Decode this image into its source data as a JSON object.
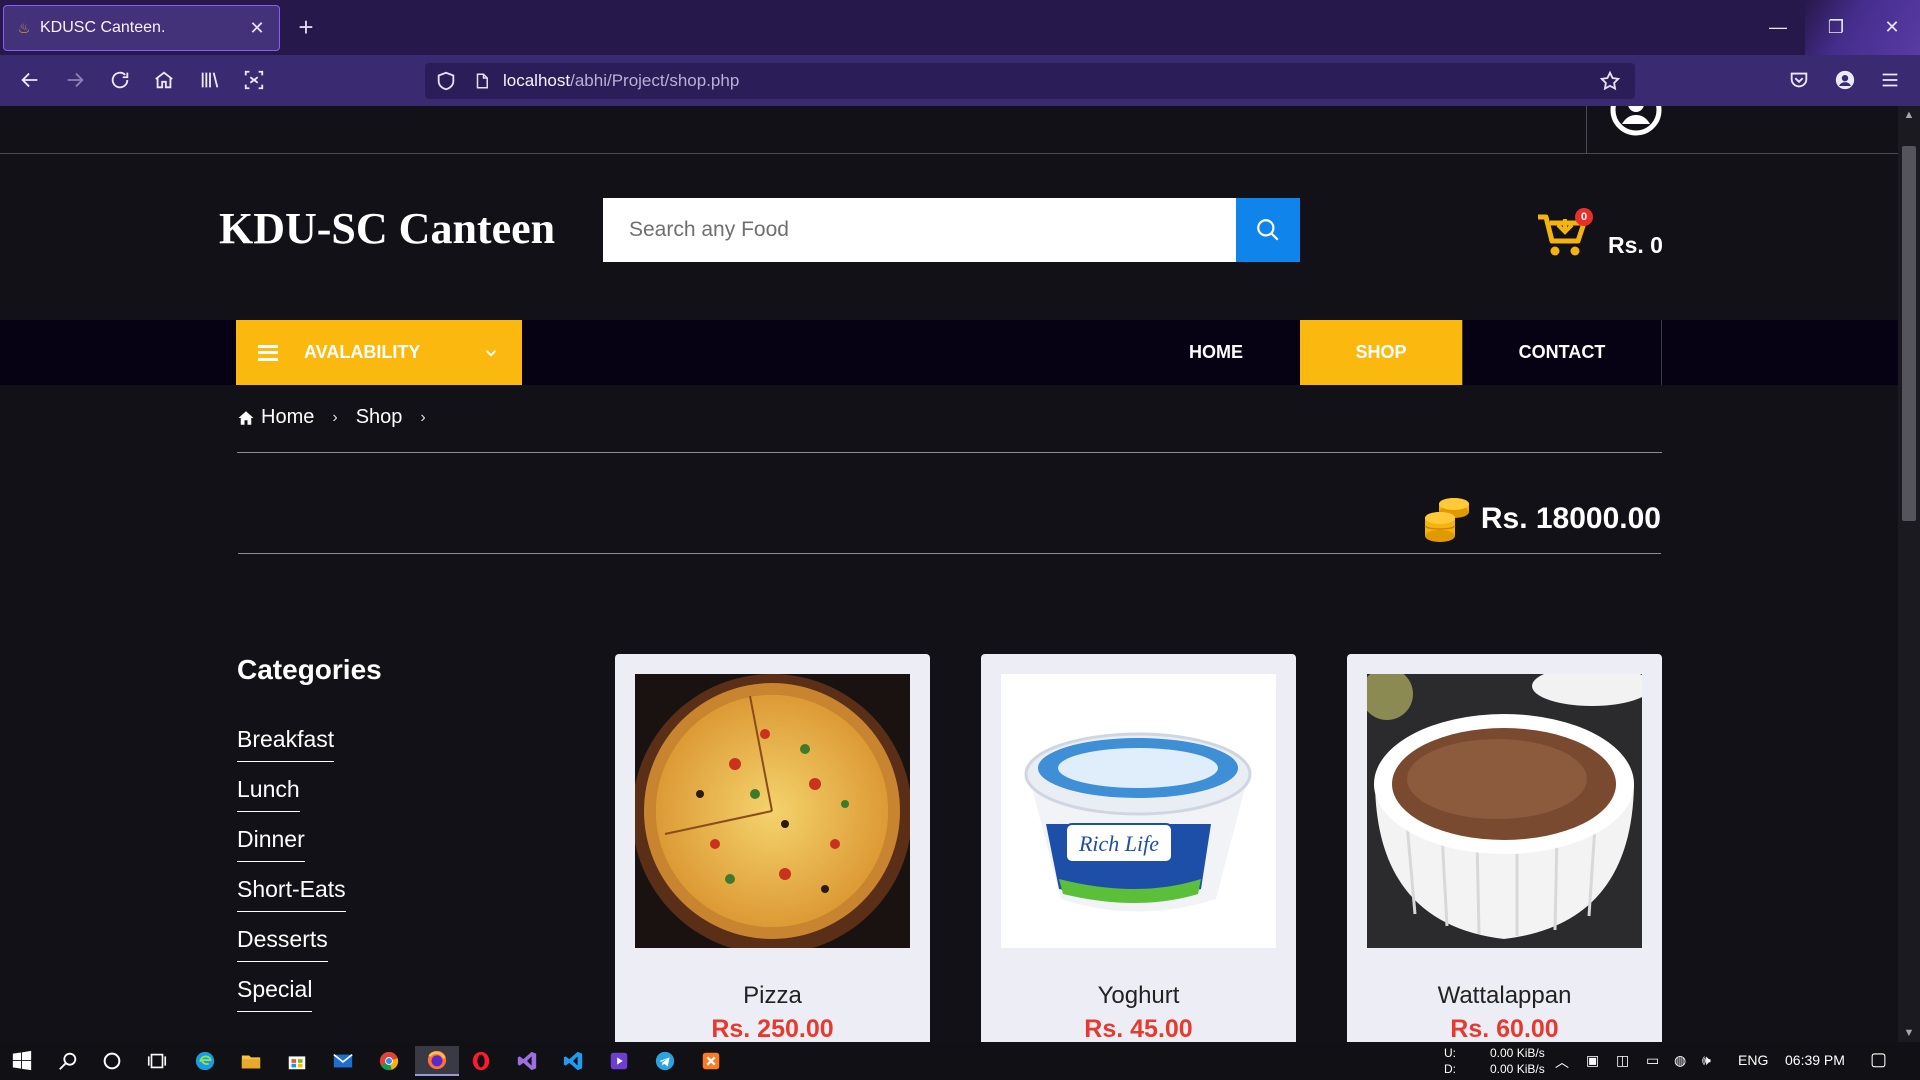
{
  "browser": {
    "tab_title": "KDUSC Canteen.",
    "url_host": "localhost",
    "url_path": "/abhi/Project/shop.php"
  },
  "header": {
    "brand": "KDU-SC Canteen",
    "search_placeholder": "Search any Food",
    "cart_count": "0",
    "cart_total": "Rs. 0"
  },
  "nav": {
    "availability_label": "AVALABILITY",
    "links": [
      "HOME",
      "SHOP",
      "CONTACT"
    ],
    "active": "SHOP"
  },
  "breadcrumb": [
    "Home",
    "Shop"
  ],
  "balance": "Rs. 18000.00",
  "categories": {
    "title": "Categories",
    "items": [
      "Breakfast",
      "Lunch",
      "Dinner",
      "Short-Eats",
      "Desserts",
      "Special"
    ]
  },
  "products": [
    {
      "name": "Pizza",
      "price": "Rs. 250.00"
    },
    {
      "name": "Yoghurt",
      "price": "Rs. 45.00",
      "brand_label": "Rich Life"
    },
    {
      "name": "Wattalappan",
      "price": "Rs. 60.00"
    }
  ],
  "taskbar": {
    "net_up_label": "U:",
    "net_up": "0.00 KiB/s",
    "net_down_label": "D:",
    "net_down": "0.00 KiB/s",
    "lang": "ENG",
    "time": "06:39 PM"
  },
  "colors": {
    "accent_yellow": "#fbb80f",
    "search_blue": "#0f84ea",
    "price_red": "#e63a2e",
    "chrome_purple": "#3a2a71"
  }
}
